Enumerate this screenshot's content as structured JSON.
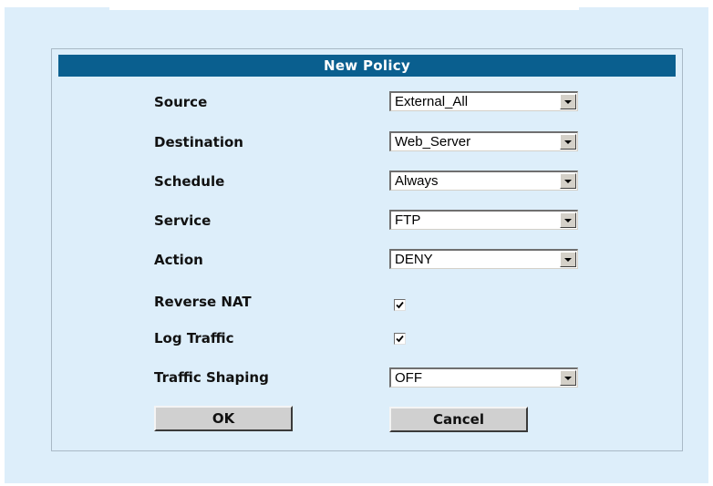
{
  "dialog": {
    "title": "New Policy"
  },
  "fields": {
    "source": {
      "label": "Source",
      "value": "External_All"
    },
    "destination": {
      "label": "Destination",
      "value": "Web_Server"
    },
    "schedule": {
      "label": "Schedule",
      "value": "Always"
    },
    "service": {
      "label": "Service",
      "value": "FTP"
    },
    "action": {
      "label": "Action",
      "value": "DENY"
    },
    "reverse_nat": {
      "label": "Reverse NAT",
      "checked": true
    },
    "log_traffic": {
      "label": "Log Traffic",
      "checked": true
    },
    "traffic_shaping": {
      "label": "Traffic Shaping",
      "value": "OFF"
    }
  },
  "buttons": {
    "ok": "OK",
    "cancel": "Cancel"
  },
  "icons": {
    "dropdown": "chevron-down-icon",
    "check": "check-icon"
  },
  "colors": {
    "background": "#ddeefa",
    "title_bar": "#0a5f8f",
    "button_face": "#d0d0d0"
  }
}
